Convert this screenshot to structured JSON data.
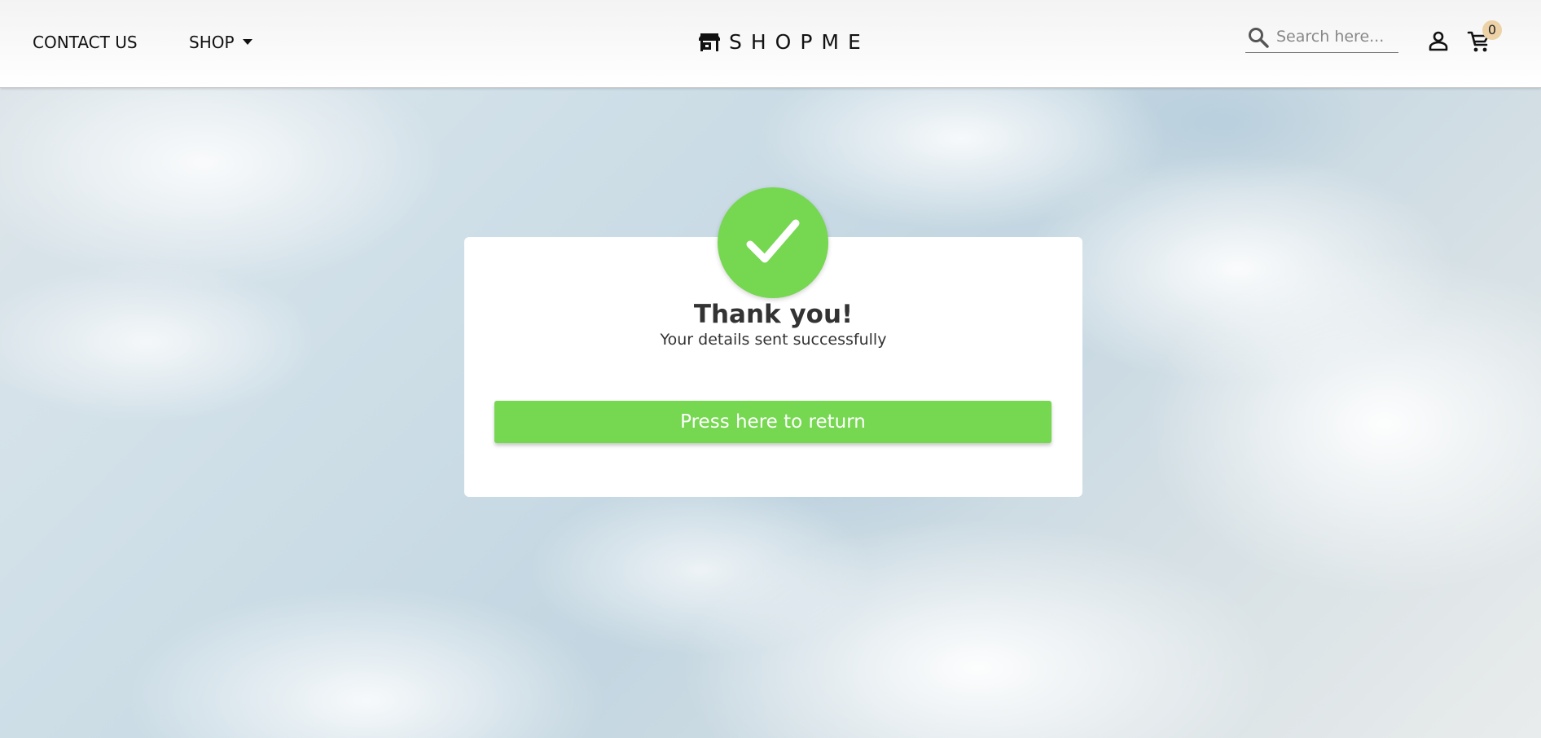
{
  "colors": {
    "accent": "#76d751",
    "badge": "#ecd2a6",
    "header_bg": "#ffffff",
    "text": "#333333"
  },
  "header": {
    "nav": {
      "contact_label": "CONTACT US",
      "shop_label": "SHOP"
    },
    "logo": {
      "icon": "storefront-icon",
      "text": "SHOPME"
    },
    "search": {
      "icon": "search-icon",
      "placeholder": "Search here...",
      "value": ""
    },
    "account_icon": "person-icon",
    "cart": {
      "icon": "cart-icon",
      "count": "0"
    }
  },
  "confirmation": {
    "icon": "checkmark-icon",
    "title": "Thank you!",
    "message": "Your details sent successfully",
    "button_label": "Press here to return"
  }
}
